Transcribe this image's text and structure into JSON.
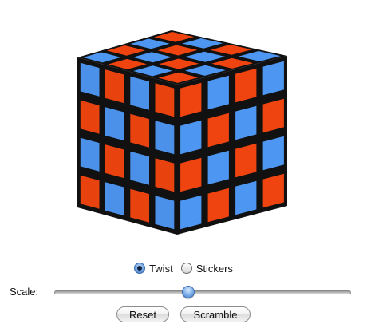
{
  "colors": {
    "blue": "#4d96f2",
    "orange": "#ef4410",
    "gap": "#111111"
  },
  "cube": {
    "size": 4,
    "faces": {
      "top": [
        [
          "orange",
          "blue",
          "orange",
          "blue"
        ],
        [
          "blue",
          "orange",
          "blue",
          "orange"
        ],
        [
          "orange",
          "blue",
          "orange",
          "blue"
        ],
        [
          "blue",
          "orange",
          "blue",
          "orange"
        ]
      ],
      "left": [
        [
          "blue",
          "orange",
          "blue",
          "orange"
        ],
        [
          "orange",
          "blue",
          "orange",
          "blue"
        ],
        [
          "blue",
          "orange",
          "blue",
          "orange"
        ],
        [
          "orange",
          "blue",
          "orange",
          "blue"
        ]
      ],
      "right": [
        [
          "orange",
          "blue",
          "orange",
          "blue"
        ],
        [
          "blue",
          "orange",
          "blue",
          "orange"
        ],
        [
          "orange",
          "blue",
          "orange",
          "blue"
        ],
        [
          "blue",
          "orange",
          "blue",
          "orange"
        ]
      ]
    }
  },
  "mode": {
    "options": [
      {
        "label": "Twist",
        "selected": true
      },
      {
        "label": "Stickers",
        "selected": false
      }
    ]
  },
  "scale": {
    "label": "Scale:",
    "value": 0.45
  },
  "buttons": {
    "reset": "Reset",
    "scramble": "Scramble"
  }
}
